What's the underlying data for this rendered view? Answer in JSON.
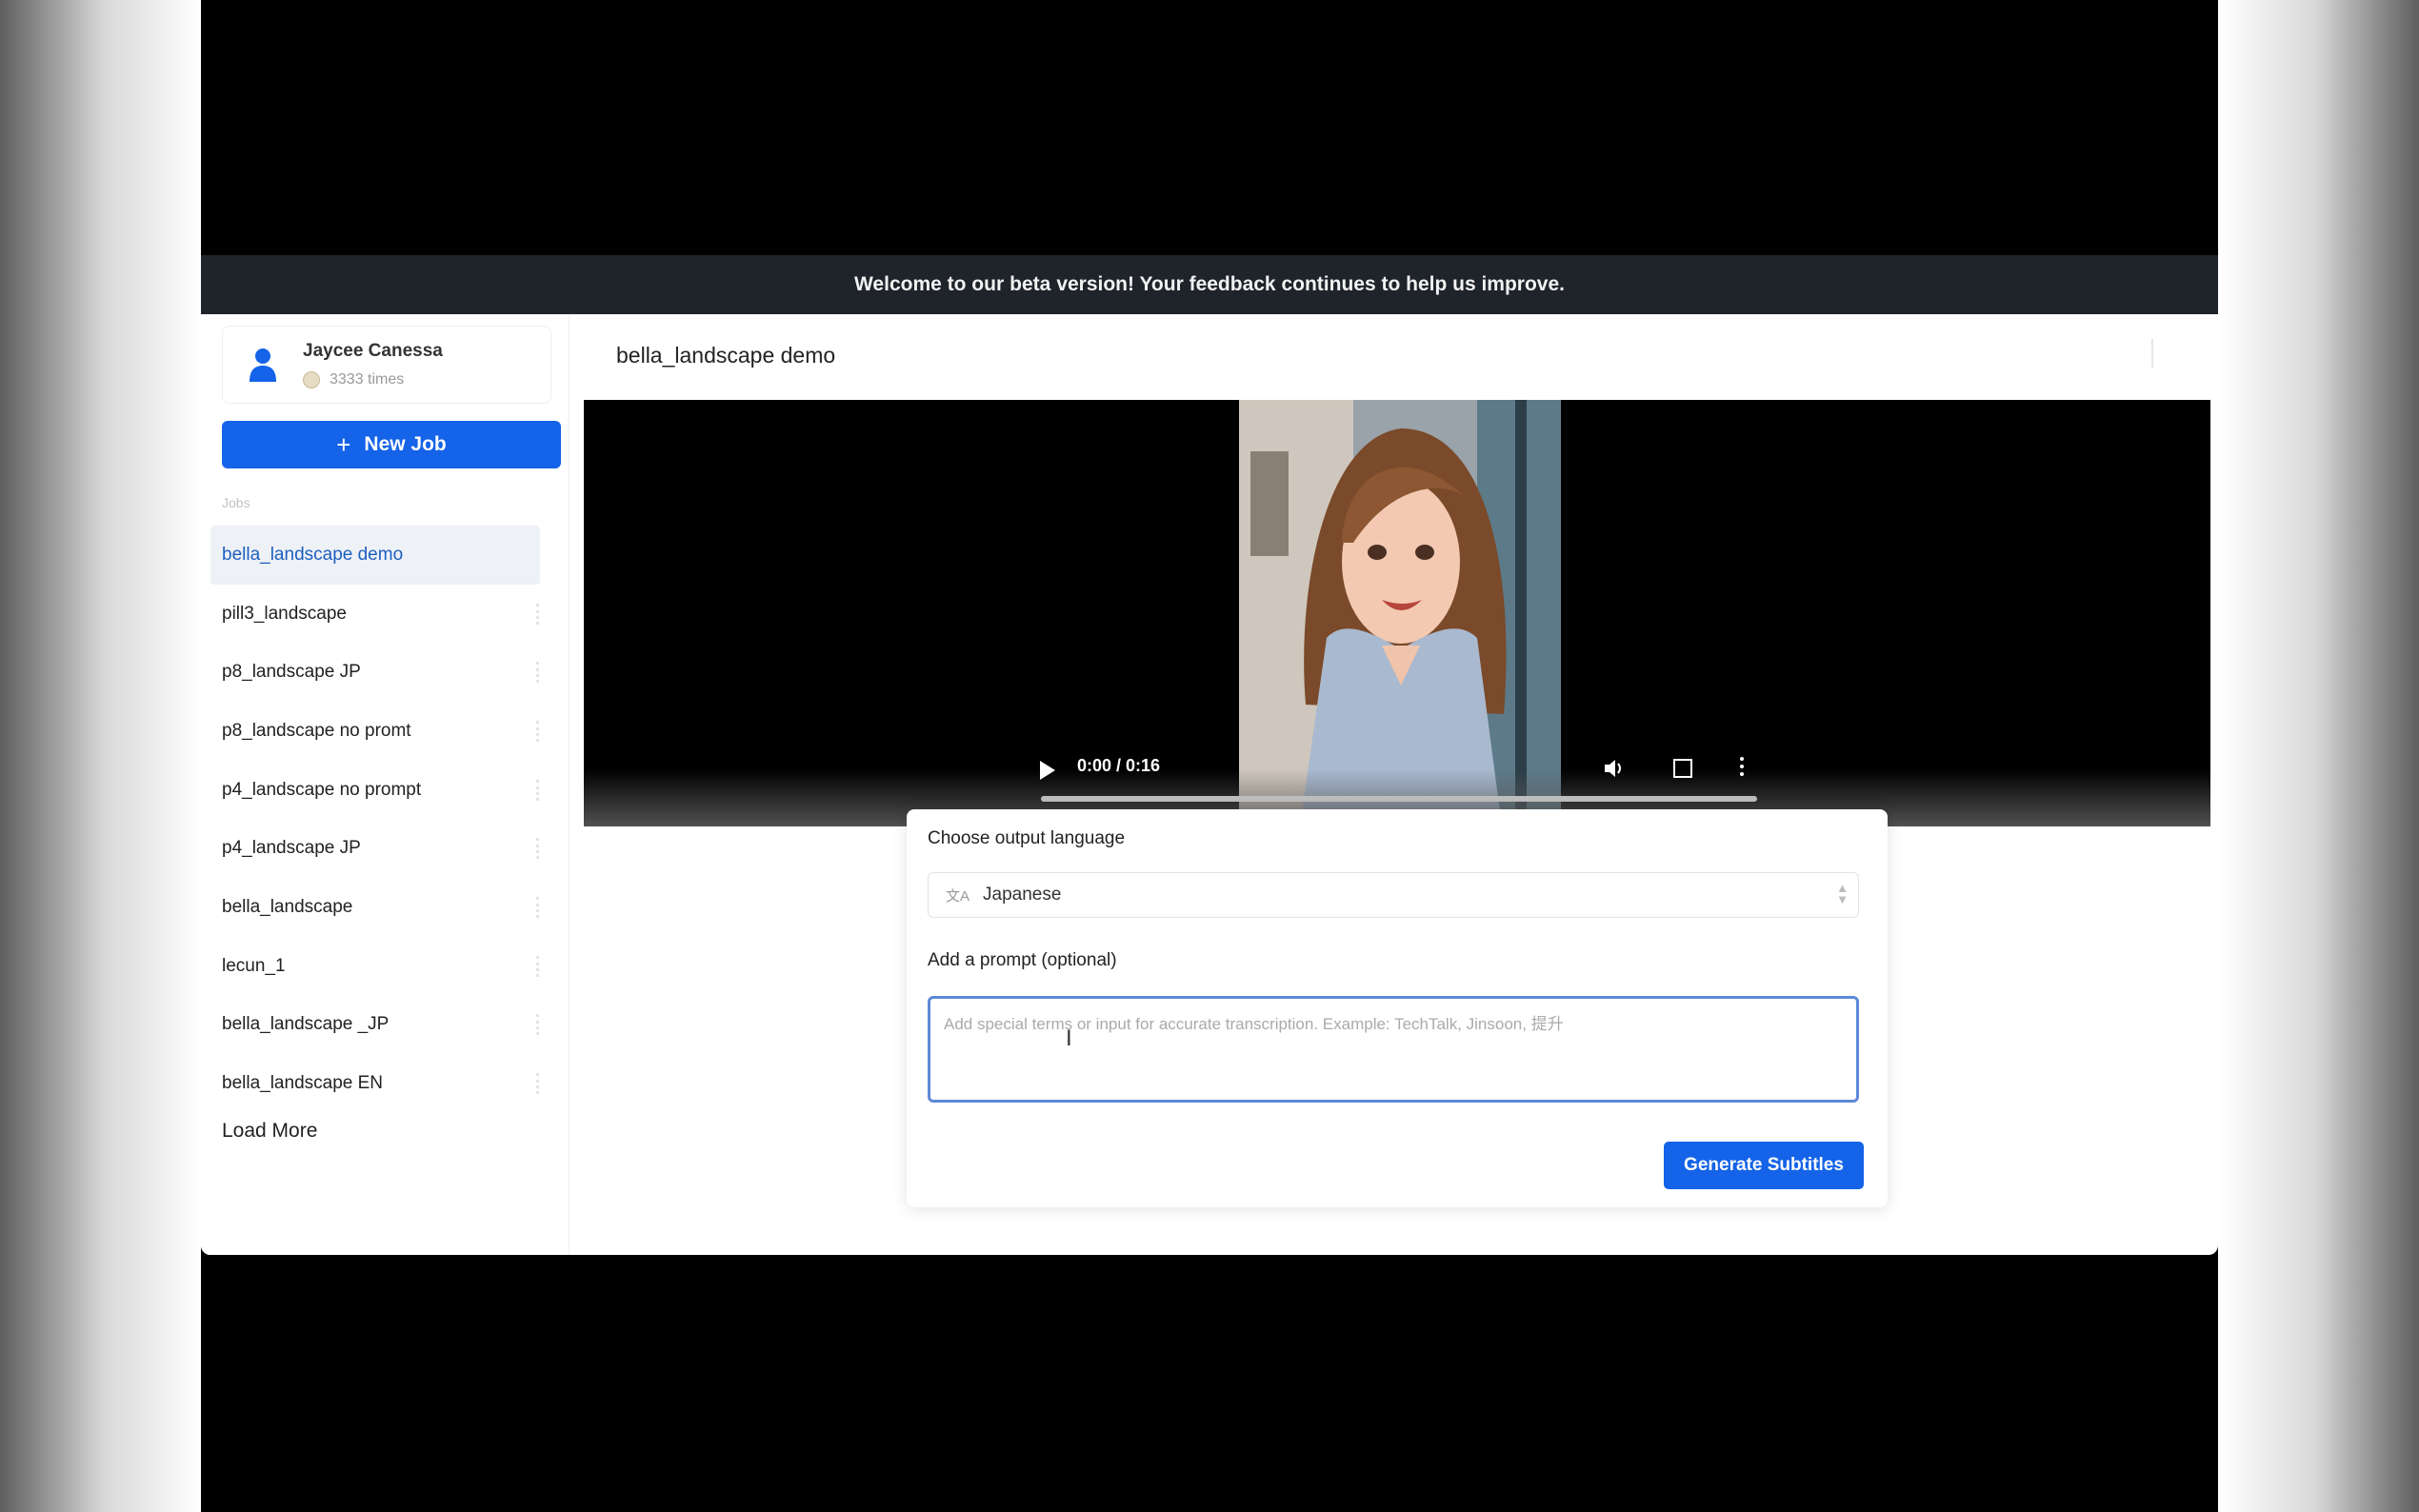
{
  "banner": {
    "prefix": "Welcome to our",
    "bold": "beta",
    "suffix": "version! Your feedback continues to help us improve."
  },
  "sidebar": {
    "user": {
      "name": "Jaycee Canessa",
      "credits": "3333 times"
    },
    "new_job_label": "New Job",
    "section_label": "Jobs",
    "jobs": [
      "bella_landscape demo",
      "pill3_landscape",
      "p8_landscape JP",
      "p8_landscape no promt",
      "p4_landscape no prompt",
      "p4_landscape JP",
      "bella_landscape",
      "lecun_1",
      "bella_landscape _JP",
      "bella_landscape EN"
    ],
    "load_more_label": "Load More"
  },
  "main": {
    "title": "bella_landscape demo",
    "video": {
      "time": "0:00 / 0:16",
      "progress": 0
    },
    "output_language_label": "Choose output language",
    "language_icon": "文A",
    "selected_language": "Japanese",
    "prompt_label": "Add a prompt (optional)",
    "prompt_placeholder": "Add special terms or input for accurate transcription. Example: TechTalk, Jinsoon, 提升",
    "generate_label": "Generate Subtitles"
  },
  "colors": {
    "accent": "#1463e8",
    "banner_bg": "#1f232a",
    "active_job_text": "#1d5fc0"
  }
}
